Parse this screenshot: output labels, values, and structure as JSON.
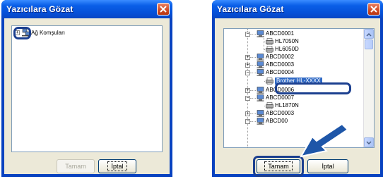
{
  "window1": {
    "title": "Yazıcılara Gözat",
    "tree_root_label": "Ağ Komşuları",
    "ok_label": "Tamam",
    "cancel_label": "İptal"
  },
  "window2": {
    "title": "Yazıcılara Gözat",
    "tree_items": [
      "ABCD0001",
      "HL7050N",
      "HL6050D",
      "ABCD0002",
      "ABCD0003",
      "ABCD0004",
      "Brother HL-XXXX",
      "ABCD0006",
      "ABCD0007",
      "HL1870N",
      "ABCD0003",
      "ABCD00"
    ],
    "ok_label": "Tamam",
    "cancel_label": "İptal"
  },
  "colors": {
    "titlebar": "#0550d8",
    "window_frame": "#0842c0",
    "highlight_outline": "#1b3f8f",
    "selection": "#316ac5",
    "callout_arrow": "#1e56a8"
  },
  "icons": [
    "close-icon",
    "network-icon",
    "computer-icon",
    "printer-icon",
    "expand-icon",
    "collapse-icon",
    "scroll-up-icon",
    "scroll-down-icon",
    "arrow-pointer-icon"
  ]
}
